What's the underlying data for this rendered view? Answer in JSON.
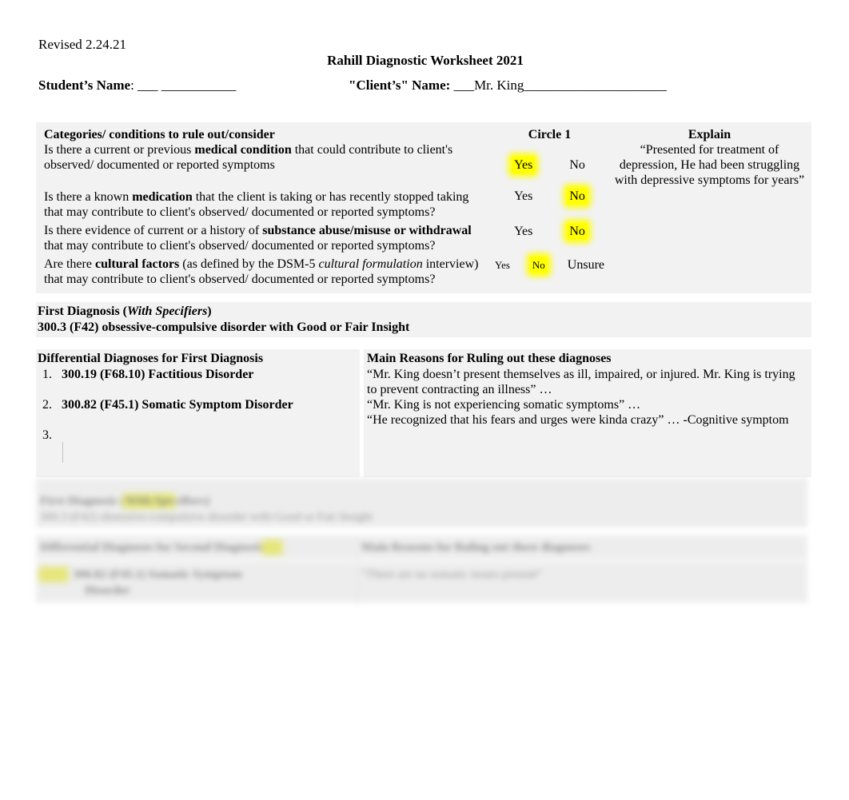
{
  "header": {
    "revised": "Revised 2.24.21",
    "doc_title": "Rahill Diagnostic Worksheet 2021",
    "student_label": "Student’s Name",
    "student_colon": ": ___ ___________",
    "client_label": "\"Client’s\"  Name:",
    "client_blank_pre": "___",
    "client_value": "Mr. King",
    "client_blank_post": "_____________________"
  },
  "rule_out_table": {
    "columns": {
      "categories": "Categories/ conditions to rule out/consider",
      "circle": "Circle 1",
      "explain": "Explain"
    },
    "rows": [
      {
        "q_pre": "Is there a current or previous ",
        "q_bold": "medical condition",
        "q_post": " that could contribute to client's observed/ documented or reported symptoms",
        "options": [
          {
            "label": "Yes",
            "highlighted": true
          },
          {
            "label": "No",
            "highlighted": false
          }
        ],
        "explain": "“Presented for treatment of depression, He had been struggling with depressive symptoms for years”"
      },
      {
        "q_pre": "Is there a known ",
        "q_bold": "medication",
        "q_post": " that the client is taking or has recently stopped taking that may contribute to client's observed/ documented or reported symptoms?",
        "options": [
          {
            "label": "Yes",
            "highlighted": false
          },
          {
            "label": "No",
            "highlighted": true
          }
        ],
        "explain": ""
      },
      {
        "q_pre": "Is there evidence of current or a history of ",
        "q_bold": "substance abuse/misuse or withdrawal",
        "q_post": " that may contribute to client's observed/ documented or reported symptoms?",
        "options": [
          {
            "label": "Yes",
            "highlighted": false
          },
          {
            "label": "No",
            "highlighted": true
          }
        ],
        "explain": ""
      },
      {
        "q_pre": "Are there ",
        "q_bold": "cultural factors",
        "q_mid": " (as defined by the DSM-5 ",
        "q_italic": "cultural formulation",
        "q_post": " interview) that may contribute to client's observed/ documented or reported symptoms?",
        "options": [
          {
            "label": "Yes",
            "highlighted": false
          },
          {
            "label": "No",
            "highlighted": true
          },
          {
            "label": "Unsure",
            "highlighted": false
          }
        ],
        "explain": ""
      }
    ]
  },
  "first_diagnosis": {
    "label_pre": "First Diagnosis (",
    "label_italic": "With Specifiers",
    "label_post": ")",
    "value": "300.3 (F42) obsessive-compulsive disorder with Good or Fair Insight"
  },
  "differential": {
    "left_header": "Differential Diagnoses for First Diagnosis",
    "right_header": "Main Reasons for Ruling out these diagnoses",
    "items": [
      {
        "num": "1.",
        "text": "300.19 (F68.10) Factitious Disorder"
      },
      {
        "num": "2.",
        "text": "300.82 (F45.1) Somatic Symptom Disorder"
      },
      {
        "num": "3.",
        "text": ""
      }
    ],
    "reasons": [
      "“Mr. King doesn’t present themselves as ill, impaired, or injured. Mr. King is trying to prevent contracting an illness” …",
      "“Mr. King is not experiencing somatic symptoms” …",
      "“He recognized that his fears and urges were kinda crazy” … -Cognitive symptom"
    ]
  },
  "ghost_block": {
    "note": "blurred duplicate of the diagnosis / differential section",
    "line1": "First Diagnosis (With Specifiers)",
    "line2": "300.3 (F42) obsessive-compulsive disorder with Good or Fair Insight",
    "line3": "Differential Diagnoses for Second Diagnosis",
    "line4": "Main Reasons for Ruling out these diagnoses",
    "line5": "300.82 (F45.1) Somatic Symptom Disorder",
    "line6": "“There are no somatic issues present”"
  },
  "colors": {
    "highlight": "#ffff00",
    "table_bg": "#f2f2f2",
    "page_bg": "#ffffff",
    "text": "#000000"
  }
}
